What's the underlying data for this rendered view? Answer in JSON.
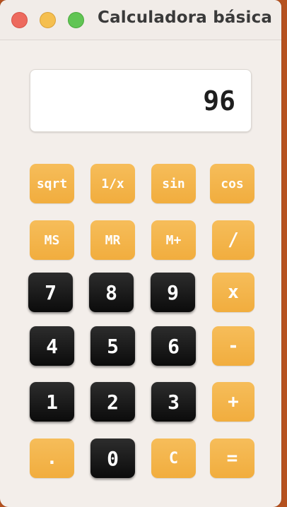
{
  "window": {
    "title": "Calculadora básica"
  },
  "display": {
    "value": "96"
  },
  "buttons": {
    "sqrt": "sqrt",
    "inverse": "1/x",
    "sin": "sin",
    "cos": "cos",
    "ms": "MS",
    "mr": "MR",
    "mplus": "M+",
    "divide": "/",
    "seven": "7",
    "eight": "8",
    "nine": "9",
    "multiply": "x",
    "four": "4",
    "five": "5",
    "six": "6",
    "minus": "-",
    "one": "1",
    "two": "2",
    "three": "3",
    "plus": "+",
    "decimal": ".",
    "zero": "0",
    "clear": "C",
    "equals": "="
  },
  "colors": {
    "orange_button": "#f3b349",
    "black_button": "#111111",
    "window_background": "#f3eeea",
    "desktop_background": "#b5511f"
  }
}
